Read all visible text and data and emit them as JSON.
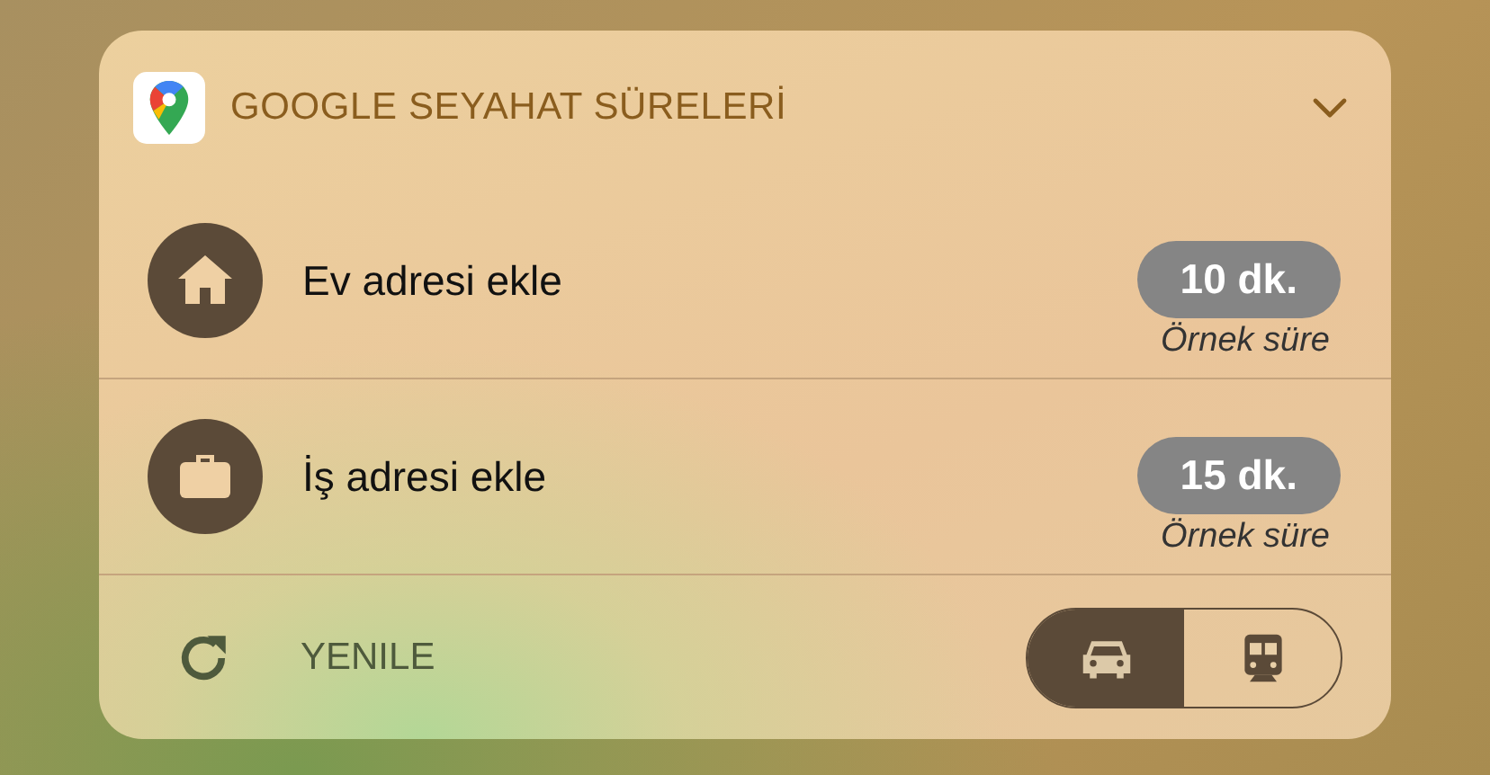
{
  "widget": {
    "title": "GOOGLE SEYAHAT SÜRELERİ",
    "expanded": false
  },
  "destinations": [
    {
      "kind": "home",
      "label": "Ev adresi ekle",
      "duration": "10 dk.",
      "note": "Örnek süre"
    },
    {
      "kind": "work",
      "label": "İş adresi ekle",
      "duration": "15 dk.",
      "note": "Örnek süre"
    }
  ],
  "refresh": {
    "label": "YENILE"
  },
  "modes": [
    {
      "kind": "car",
      "selected": true
    },
    {
      "kind": "train",
      "selected": false
    }
  ]
}
